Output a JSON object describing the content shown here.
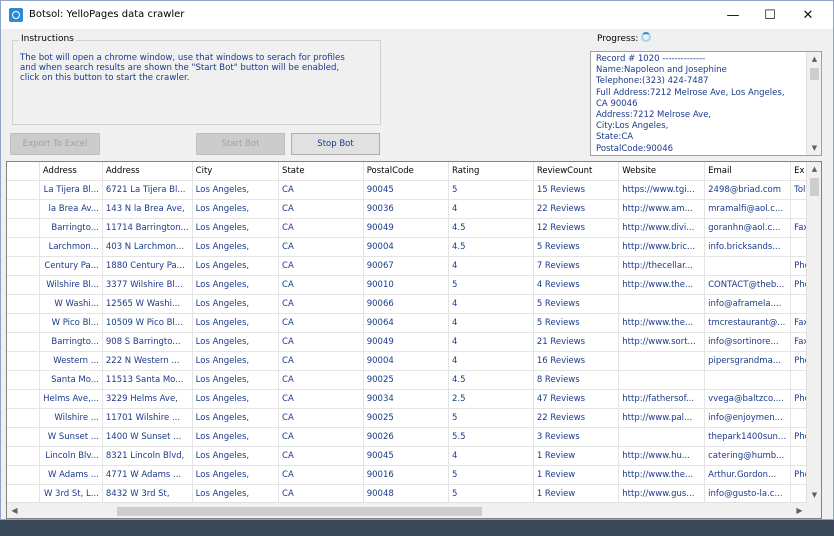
{
  "window": {
    "title": "Botsol: YelloPages data crawler"
  },
  "controls": {
    "minimize": "—",
    "maximize": "☐",
    "close": "✕"
  },
  "instructions": {
    "legend": "Instructions",
    "lines": [
      "The bot will open a chrome window, use that windows to serach for profiles",
      "and when search results are shown the \"Start Bot\" button will be enabled,",
      "click on this button to start the crawler."
    ]
  },
  "buttons": {
    "export": "Export To Excel",
    "start": "Start Bot",
    "stop": "Stop Bot"
  },
  "progress": {
    "label": "Progress:",
    "lines": [
      "Record # 1020 --------------",
      "Name:Napoleon and Josephine",
      "Telephone:(323) 424-7487",
      "Full Address:7212 Melrose Ave, Los Angeles,",
      "CA 90046",
      "Address:7212 Melrose Ave,",
      "City:Los Angeles,",
      "State:CA",
      "PostalCode:90046"
    ]
  },
  "table": {
    "columns": [
      "Address",
      "Address",
      "City",
      "State",
      "PostalCode",
      "Rating",
      "ReviewCount",
      "Website",
      "Email",
      "Ex"
    ],
    "rows": [
      [
        "La Tijera Bl...",
        "6721 La Tijera Bl...",
        "Los Angeles,",
        "CA",
        "90045",
        "5",
        "15 Reviews",
        "https://www.tgi...",
        "2498@briad.com",
        "Toll"
      ],
      [
        "la Brea Av...",
        "143 N la Brea Ave,",
        "Los Angeles,",
        "CA",
        "90036",
        "4",
        "22 Reviews",
        "http://www.am...",
        "mramalfi@aol.c...",
        ""
      ],
      [
        "Barringto...",
        "11714 Barrington...",
        "Los Angeles,",
        "CA",
        "90049",
        "4.5",
        "12 Reviews",
        "http://www.divi...",
        "goranhn@aol.c...",
        "Fax"
      ],
      [
        "Larchmon...",
        "403 N Larchmon...",
        "Los Angeles,",
        "CA",
        "90004",
        "4.5",
        "5 Reviews",
        "http://www.bric...",
        "info.bricksands...",
        ""
      ],
      [
        "Century Pa...",
        "1880 Century Pa...",
        "Los Angeles,",
        "CA",
        "90067",
        "4",
        "7 Reviews",
        "http://thecellar...",
        "",
        "Pho"
      ],
      [
        "Wilshire Bl...",
        "3377 Wilshire Bl...",
        "Los Angeles,",
        "CA",
        "90010",
        "5",
        "4 Reviews",
        "http://www.the...",
        "CONTACT@theb...",
        "Pho"
      ],
      [
        "W Washi...",
        "12565 W Washi...",
        "Los Angeles,",
        "CA",
        "90066",
        "4",
        "5 Reviews",
        "",
        "info@aframela....",
        ""
      ],
      [
        "W Pico Bl...",
        "10509 W Pico Bl...",
        "Los Angeles,",
        "CA",
        "90064",
        "4",
        "5 Reviews",
        "http://www.the...",
        "tmcrestaurant@...",
        "Fax"
      ],
      [
        "Barringto...",
        "908 S Barringto...",
        "Los Angeles,",
        "CA",
        "90049",
        "4",
        "21 Reviews",
        "http://www.sort...",
        "info@sortinore...",
        "Fax"
      ],
      [
        "Western ...",
        "222 N Western ...",
        "Los Angeles,",
        "CA",
        "90004",
        "4",
        "16 Reviews",
        "",
        "pipersgrandma...",
        "Pho"
      ],
      [
        "Santa Mo...",
        "11513 Santa Mo...",
        "Los Angeles,",
        "CA",
        "90025",
        "4.5",
        "8 Reviews",
        "",
        "",
        ""
      ],
      [
        "Helms Ave,...",
        "3229 Helms Ave,",
        "Los Angeles,",
        "CA",
        "90034",
        "2.5",
        "47 Reviews",
        "http://fathersof...",
        "vvega@baltzco....",
        "Pho"
      ],
      [
        "Wilshire ...",
        "11701 Wilshire ...",
        "Los Angeles,",
        "CA",
        "90025",
        "5",
        "22 Reviews",
        "http://www.pal...",
        "info@enjoymen...",
        ""
      ],
      [
        "W Sunset ...",
        "1400 W Sunset ...",
        "Los Angeles,",
        "CA",
        "90026",
        "5.5",
        "3 Reviews",
        "",
        "thepark1400sun...",
        "Pho"
      ],
      [
        "Lincoln Blv...",
        "8321 Lincoln Blvd,",
        "Los Angeles,",
        "CA",
        "90045",
        "4",
        "1 Review",
        "http://www.hu...",
        "catering@humb...",
        ""
      ],
      [
        "W Adams ...",
        "4771 W Adams ...",
        "Los Angeles,",
        "CA",
        "90016",
        "5",
        "1 Review",
        "http://www.the...",
        "Arthur.Gordon...",
        "Pho"
      ],
      [
        "W 3rd St, L...",
        "8432 W 3rd St,",
        "Los Angeles,",
        "CA",
        "90048",
        "5",
        "1 Review",
        "http://www.gus...",
        "info@gusto-la.c...",
        ""
      ]
    ]
  },
  "scroll": {
    "up": "▲",
    "down": "▼",
    "left": "◀",
    "right": "▶"
  }
}
